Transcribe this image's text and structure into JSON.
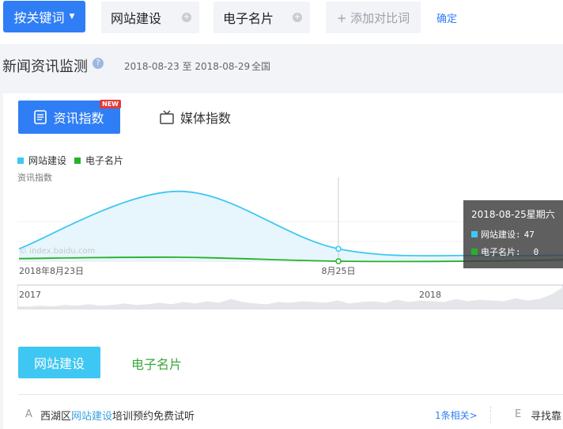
{
  "top": {
    "keyword_button": "按关键词",
    "keywords": [
      "网站建设",
      "电子名片"
    ],
    "add_label": "+ 添加对比词",
    "confirm": "确定"
  },
  "header": {
    "title": "新闻资讯监测",
    "date_range": "2018-08-23 至 2018-08-29",
    "region": "全国"
  },
  "tabs": {
    "active": "资讯指数",
    "new_badge": "NEW",
    "inactive": "媒体指数"
  },
  "legend": [
    "网站建设",
    "电子名片"
  ],
  "tooltip": {
    "title": "2018-08-25星期六",
    "rows": [
      {
        "label": "网站建设:",
        "value": "47"
      },
      {
        "label": "电子名片:",
        "value": "0"
      }
    ]
  },
  "colors": {
    "primary": "#2f7ef5",
    "series1": "#3ec7f2",
    "series2": "#29b02a"
  },
  "chart_data": {
    "type": "area",
    "ylabel": "资讯指数",
    "watermark": "© index.baidu.com",
    "x_tick_labels": [
      "2018年8月23日",
      "8月25日"
    ],
    "x": [
      "2018-08-23",
      "2018-08-24",
      "2018-08-25",
      "2018-08-26",
      "2018-08-27",
      "2018-08-28",
      "2018-08-29"
    ],
    "series": [
      {
        "name": "网站建设",
        "values": [
          47,
          265,
          47,
          22,
          28,
          30,
          33
        ]
      },
      {
        "name": "电子名片",
        "values": [
          10,
          15,
          0,
          1,
          12,
          22,
          30
        ]
      }
    ],
    "ylim": [
      0,
      300
    ],
    "overview_labels": [
      "2017",
      "2018"
    ]
  },
  "segments": {
    "active": "网站建设",
    "inactive": "电子名片"
  },
  "news": {
    "row1": {
      "letter": "A",
      "prefix": "西湖区",
      "highlight": "网站建设",
      "suffix": "培训预约免费试听",
      "related": "1条相关>"
    },
    "row2": {
      "letter": "E",
      "text": "寻找靠"
    }
  }
}
